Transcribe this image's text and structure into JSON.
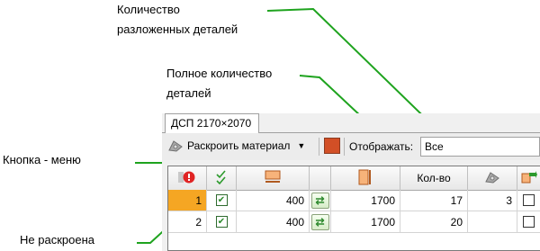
{
  "annotations": {
    "laid_out_count": [
      "Количество",
      "разложенных деталей"
    ],
    "total_count": [
      "Полное количество",
      "деталей"
    ],
    "menu_button": "Кнопка - меню",
    "not_cut": "Не раскроена"
  },
  "tab": {
    "label": "ДСП 2170×2070"
  },
  "toolbar": {
    "cut_material_label": "Раскроить материал",
    "show_label": "Отображать:",
    "show_value": "Все",
    "color_swatch": "#d24f26"
  },
  "grid": {
    "headers": {
      "quantity": "Кол-во"
    },
    "rows": [
      {
        "index": "1",
        "checked": true,
        "length": "400",
        "width": "1700",
        "qty": "17",
        "laid_out": "3",
        "selected": true
      },
      {
        "index": "2",
        "checked": true,
        "length": "400",
        "width": "1700",
        "qty": "20",
        "laid_out": "",
        "selected": false
      }
    ],
    "selected_row_color": "#f5a623"
  }
}
